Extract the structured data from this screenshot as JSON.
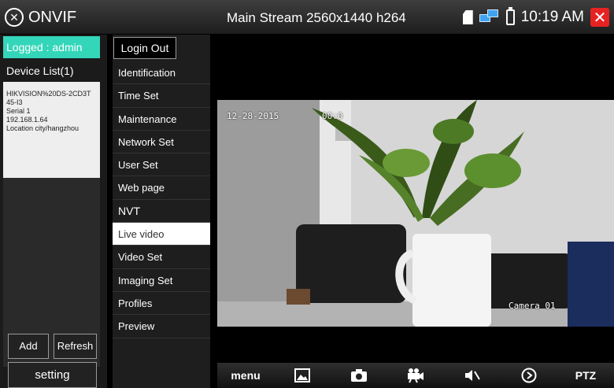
{
  "app": {
    "name": "ONVIF",
    "logo_icon": "x-circle-icon"
  },
  "header": {
    "stream_title": "Main Stream 2560x1440 h264",
    "time": "10:19 AM"
  },
  "left": {
    "logged": "Logged : admin",
    "device_list_title": "Device List(1)",
    "device": {
      "line1": "HIKVISION%20DS-2CD3T",
      "line2": "45-I3",
      "line3": "Serial 1",
      "line4": "192.168.1.64",
      "line5": "Location city/hangzhou"
    },
    "add_label": "Add",
    "refresh_label": "Refresh",
    "setting_label": "setting"
  },
  "menu": {
    "login_out": "Login Out",
    "items": [
      {
        "label": "Identification"
      },
      {
        "label": "Time Set"
      },
      {
        "label": "Maintenance"
      },
      {
        "label": "Network Set"
      },
      {
        "label": "User Set"
      },
      {
        "label": "Web page"
      },
      {
        "label": "NVT"
      },
      {
        "label": "Live video"
      },
      {
        "label": "Video Set"
      },
      {
        "label": "Imaging Set"
      },
      {
        "label": "Profiles"
      },
      {
        "label": "Preview"
      }
    ]
  },
  "video": {
    "osd_date": "12-28-2015",
    "osd_time": "00:0",
    "osd_camera": "Camera 01"
  },
  "toolbar": {
    "menu_label": "menu",
    "ptz_label": "PTZ"
  },
  "colors": {
    "logged_bg": "#34d6b9",
    "close": "#e62323",
    "active_menu": "#ffffff"
  }
}
